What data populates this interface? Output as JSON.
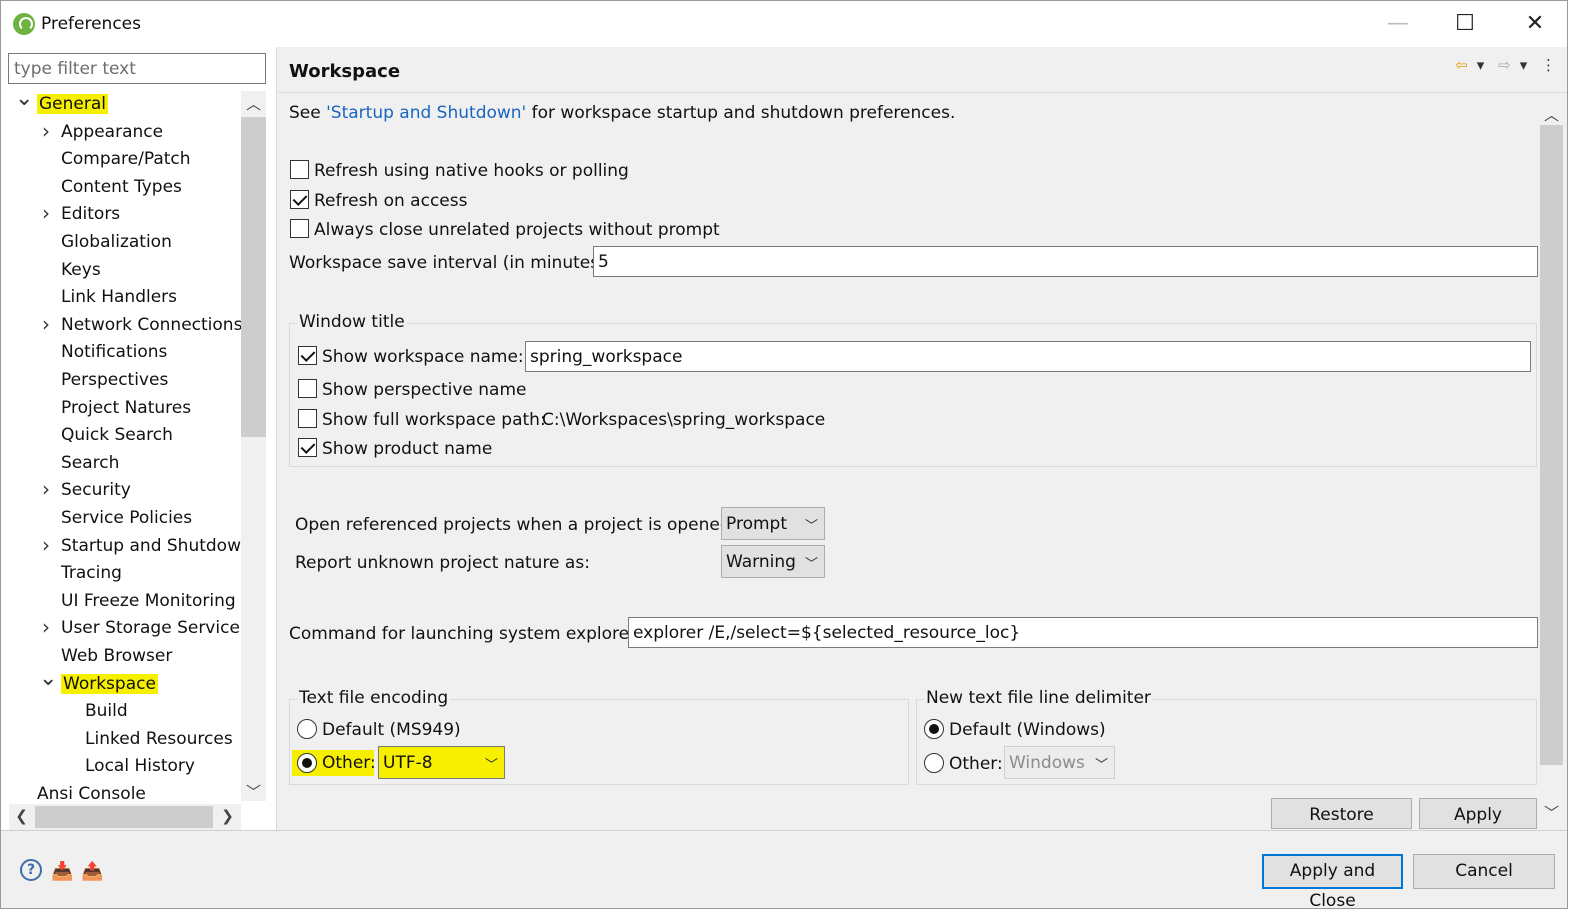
{
  "window": {
    "title": "Preferences",
    "controls": {
      "minimize": "—",
      "maximize": "☐",
      "close": "✕"
    }
  },
  "left": {
    "filter_placeholder": "type filter text",
    "tree": [
      {
        "label": "General",
        "level": 0,
        "state": "expanded",
        "highlight": true
      },
      {
        "label": "Appearance",
        "level": 1,
        "state": "collapsed"
      },
      {
        "label": "Compare/Patch",
        "level": 1,
        "state": "leaf"
      },
      {
        "label": "Content Types",
        "level": 1,
        "state": "leaf"
      },
      {
        "label": "Editors",
        "level": 1,
        "state": "collapsed"
      },
      {
        "label": "Globalization",
        "level": 1,
        "state": "leaf"
      },
      {
        "label": "Keys",
        "level": 1,
        "state": "leaf"
      },
      {
        "label": "Link Handlers",
        "level": 1,
        "state": "leaf"
      },
      {
        "label": "Network Connections",
        "level": 1,
        "state": "collapsed"
      },
      {
        "label": "Notifications",
        "level": 1,
        "state": "leaf"
      },
      {
        "label": "Perspectives",
        "level": 1,
        "state": "leaf"
      },
      {
        "label": "Project Natures",
        "level": 1,
        "state": "leaf"
      },
      {
        "label": "Quick Search",
        "level": 1,
        "state": "leaf"
      },
      {
        "label": "Search",
        "level": 1,
        "state": "leaf"
      },
      {
        "label": "Security",
        "level": 1,
        "state": "collapsed"
      },
      {
        "label": "Service Policies",
        "level": 1,
        "state": "leaf"
      },
      {
        "label": "Startup and Shutdown",
        "level": 1,
        "state": "collapsed"
      },
      {
        "label": "Tracing",
        "level": 1,
        "state": "leaf"
      },
      {
        "label": "UI Freeze Monitoring",
        "level": 1,
        "state": "leaf"
      },
      {
        "label": "User Storage Service",
        "level": 1,
        "state": "collapsed"
      },
      {
        "label": "Web Browser",
        "level": 1,
        "state": "leaf"
      },
      {
        "label": "Workspace",
        "level": 1,
        "state": "expanded",
        "highlight": true
      },
      {
        "label": "Build",
        "level": 2,
        "state": "leaf"
      },
      {
        "label": "Linked Resources",
        "level": 2,
        "state": "leaf"
      },
      {
        "label": "Local History",
        "level": 2,
        "state": "leaf"
      },
      {
        "label": "Ansi Console",
        "level": 0,
        "state": "leaf"
      }
    ]
  },
  "page": {
    "title": "Workspace",
    "intro_before": "See ",
    "intro_link": "'Startup and Shutdown'",
    "intro_after": " for workspace startup and shutdown preferences.",
    "checkboxes": [
      {
        "label": "Refresh using native hooks or polling",
        "checked": false
      },
      {
        "label": "Refresh on access",
        "checked": true
      },
      {
        "label": "Always close unrelated projects without prompt",
        "checked": false
      }
    ],
    "save_interval_label": "Workspace save interval (in minutes):",
    "save_interval_value": "5",
    "window_title_group": {
      "caption": "Window title",
      "show_workspace_name_label": "Show workspace name:",
      "show_workspace_name_checked": true,
      "workspace_name_value": "spring_workspace",
      "show_perspective_label": "Show perspective name",
      "show_perspective_checked": false,
      "show_full_path_label": "Show full workspace path:",
      "show_full_path_checked": false,
      "full_path_value": "C:\\Workspaces\\spring_workspace",
      "show_product_label": "Show product name",
      "show_product_checked": true
    },
    "open_referenced_label": "Open referenced projects when a project is opened:",
    "open_referenced_value": "Prompt",
    "report_unknown_label": "Report unknown project nature as:",
    "report_unknown_value": "Warning",
    "explorer_label": "Command for launching system explorer:",
    "explorer_value": "explorer /E,/select=${selected_resource_loc}",
    "encoding_group": {
      "caption": "Text file encoding",
      "default_label": "Default (MS949)",
      "other_label": "Other:",
      "other_value": "UTF-8",
      "selected": "other"
    },
    "delimiter_group": {
      "caption": "New text file line delimiter",
      "default_label": "Default (Windows)",
      "other_label": "Other:",
      "other_value": "Windows",
      "selected": "default"
    },
    "restore_defaults": "Restore Defaults",
    "apply": "Apply"
  },
  "footer": {
    "apply_and_close": "Apply and Close",
    "cancel": "Cancel"
  },
  "colors": {
    "highlight": "#f6ef00",
    "link": "#1a65c0",
    "default_button_border": "#0078d7"
  }
}
